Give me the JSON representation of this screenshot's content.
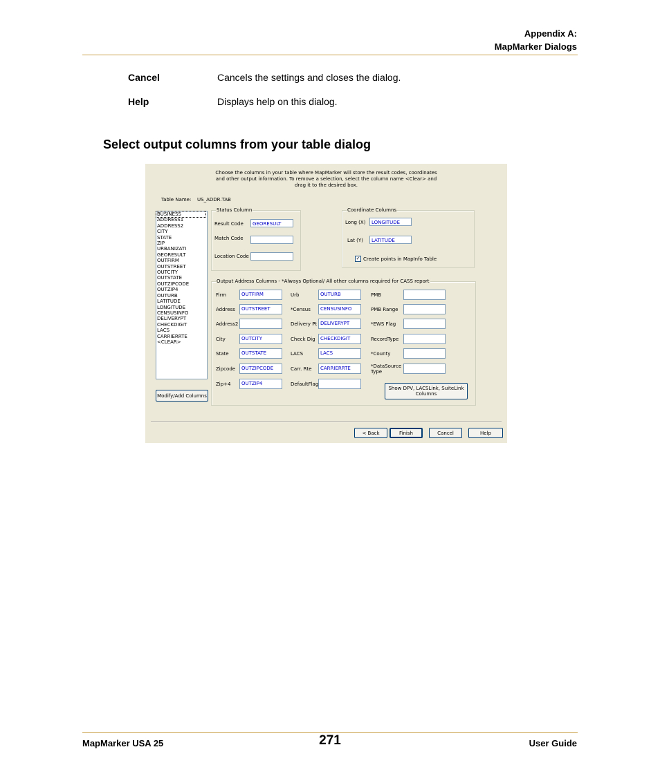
{
  "header": {
    "line1": "Appendix A:",
    "line2": "MapMarker Dialogs"
  },
  "definitions": [
    {
      "term": "Cancel",
      "desc": "Cancels the settings and closes the dialog."
    },
    {
      "term": "Help",
      "desc": "Displays help on this dialog."
    }
  ],
  "section_title": "Select output columns from your table dialog",
  "dialog": {
    "intro_lines": [
      "Choose the columns in your table where MapMarker will store the result codes, coordinates",
      "and other output information. To remove a selection, select the column name <Clear> and",
      "drag it to the desired box."
    ],
    "table_name_label": "Table Name:",
    "table_name_value": "US_ADDR.TAB",
    "columns_list": [
      "BUSINESS",
      "ADDRESS1",
      "ADDRESS2",
      "CITY",
      "STATE",
      "ZIP",
      "URBANIZATI",
      "GEORESULT",
      "OUTFIRM",
      "OUTSTREET",
      "OUTCITY",
      "OUTSTATE",
      "OUTZIPCODE",
      "OUTZIP4",
      "OUTURB",
      "LATITUDE",
      "LONGITUDE",
      "CENSUSINFO",
      "DELIVERYPT",
      "CHECKDIGIT",
      "LACS",
      "CARRIERRTE",
      "<CLEAR>"
    ],
    "modify_button": "Modify/Add Columns",
    "status_group": {
      "legend": "Status Column",
      "fields": [
        {
          "label": "Result Code",
          "value": "GEORESULT"
        },
        {
          "label": "Match Code",
          "value": ""
        },
        {
          "label": "Location Code",
          "value": ""
        }
      ]
    },
    "coord_group": {
      "legend": "Coordinate Columns",
      "fields": [
        {
          "label": "Long (X)",
          "value": "LONGITUDE"
        },
        {
          "label": "Lat (Y)",
          "value": "LATITUDE"
        }
      ],
      "checkbox_label": "Create points in MapInfo Table",
      "checkbox_checked": "✓"
    },
    "output_group": {
      "legend": "Output Address Columns -  *Always Optional/ All other columns required for CASS report",
      "col1": [
        {
          "label": "Firm",
          "value": "OUTFIRM"
        },
        {
          "label": "Address",
          "value": "OUTSTREET"
        },
        {
          "label": "Address2",
          "value": ""
        },
        {
          "label": "City",
          "value": "OUTCITY"
        },
        {
          "label": "State",
          "value": "OUTSTATE"
        },
        {
          "label": "Zipcode",
          "value": "OUTZIPCODE"
        },
        {
          "label": "Zip+4",
          "value": "OUTZIP4"
        }
      ],
      "col2": [
        {
          "label": "Urb",
          "value": "OUTURB"
        },
        {
          "label": "*Census",
          "value": "CENSUSINFO"
        },
        {
          "label": "Delivery Pt",
          "value": "DELIVERYPT"
        },
        {
          "label": "Check Dig",
          "value": "CHECKDIGIT"
        },
        {
          "label": "LACS",
          "value": "LACS"
        },
        {
          "label": "Carr. Rte",
          "value": "CARRIERRTE"
        },
        {
          "label": "DefaultFlag",
          "value": ""
        }
      ],
      "col3": [
        {
          "label": "PMB",
          "value": ""
        },
        {
          "label": "PMB Range",
          "value": ""
        },
        {
          "label": "*EWS Flag",
          "value": ""
        },
        {
          "label": "RecordType",
          "value": ""
        },
        {
          "label": "*County",
          "value": ""
        },
        {
          "label": "*DataSource Type",
          "value": ""
        }
      ],
      "show_button_line1": "Show DPV,  LACSLink, SuiteLink",
      "show_button_line2": "Columns"
    },
    "buttons": {
      "back": "< Back",
      "finish": "Finish",
      "cancel": "Cancel",
      "help": "Help"
    }
  },
  "footer": {
    "left": "MapMarker USA 25",
    "page": "271",
    "right": "User Guide"
  }
}
